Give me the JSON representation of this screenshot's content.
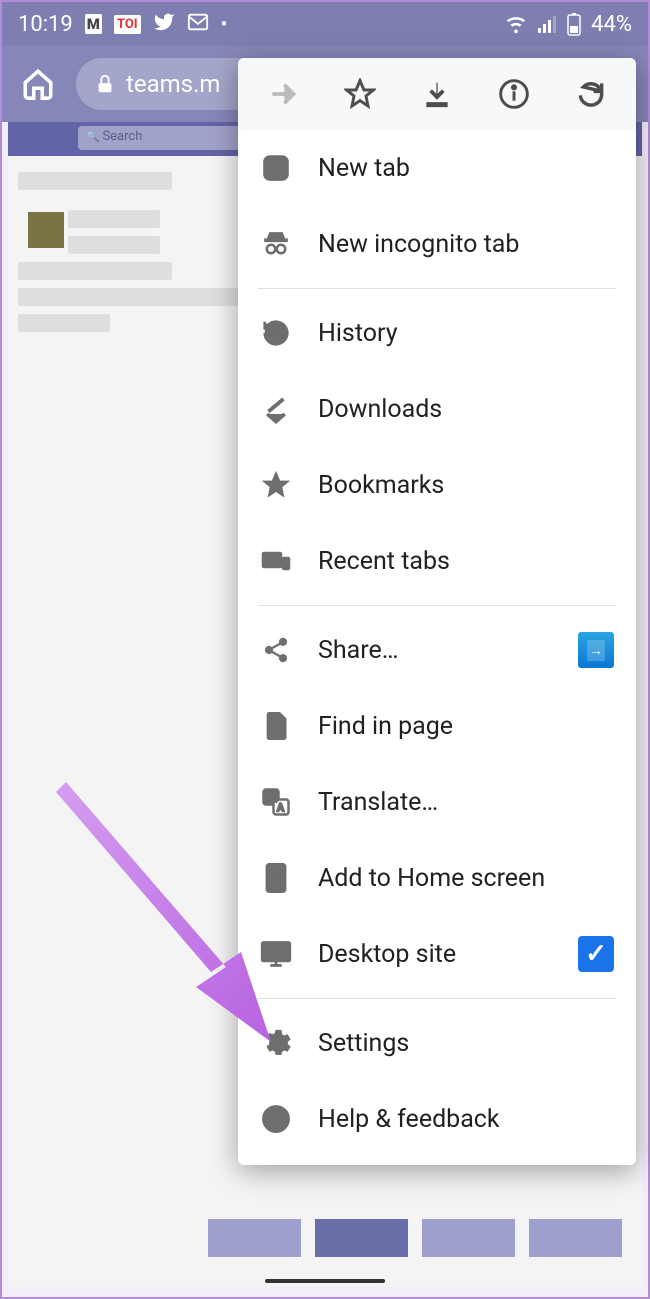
{
  "status_bar": {
    "time": "10:19",
    "battery": "44%"
  },
  "browser": {
    "url_display": "teams.m"
  },
  "background_app": {
    "search_placeholder": "Search"
  },
  "menu": {
    "new_tab": "New tab",
    "incognito": "New incognito tab",
    "history": "History",
    "downloads": "Downloads",
    "bookmarks": "Bookmarks",
    "recent_tabs": "Recent tabs",
    "share": "Share…",
    "find": "Find in page",
    "translate": "Translate…",
    "add_home": "Add to Home screen",
    "desktop": "Desktop site",
    "settings": "Settings",
    "help": "Help & feedback",
    "desktop_checked": true
  },
  "colors": {
    "accent": "#7d7fb0",
    "menu_bg": "#ffffff",
    "check": "#1a73e8",
    "arrow": "#c77ce6"
  }
}
